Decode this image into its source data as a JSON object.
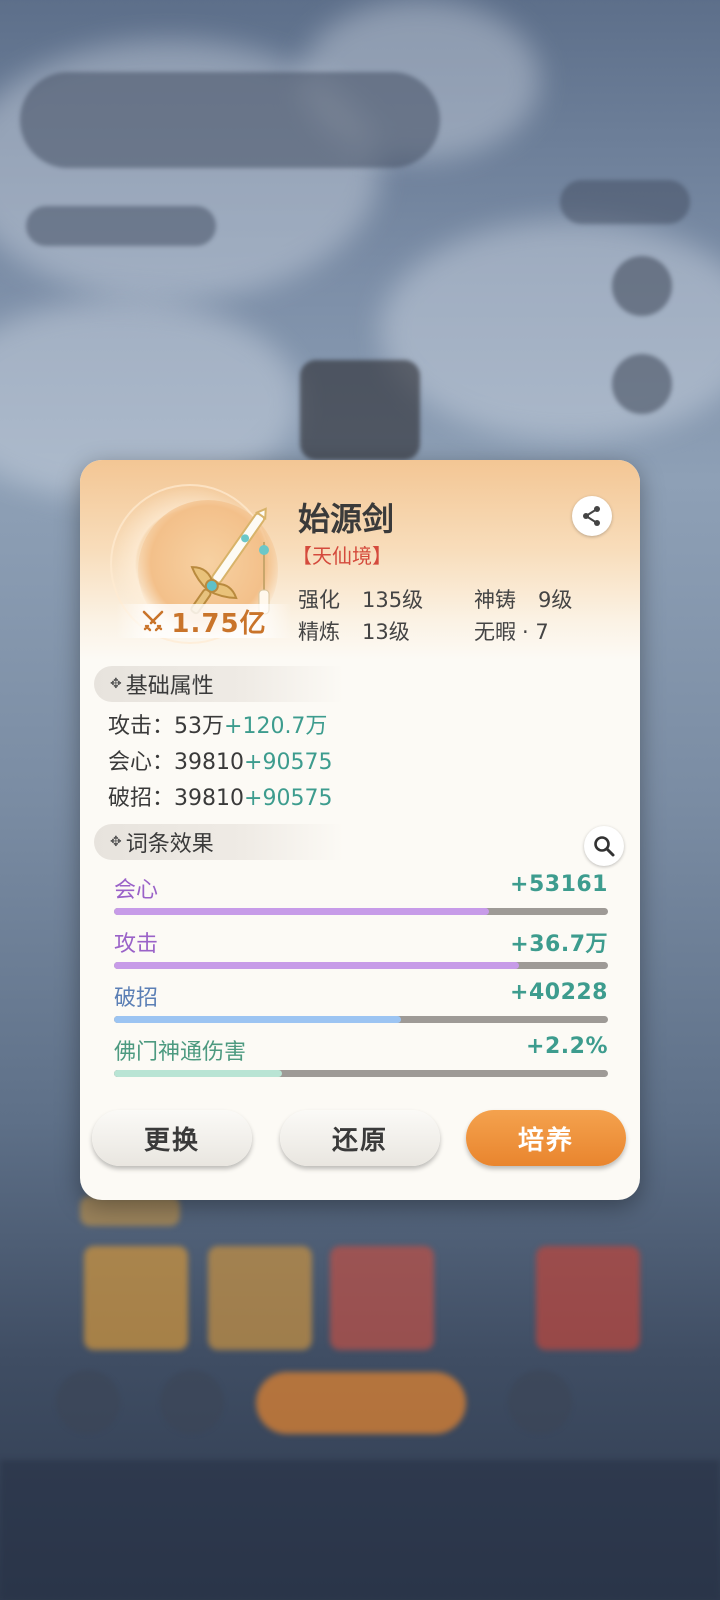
{
  "item": {
    "name": "始源剑",
    "tier": "【天仙境】",
    "power": "1.75亿",
    "stats": [
      {
        "label": "强化",
        "value": "135级"
      },
      {
        "label": "神铸",
        "value": "9级"
      },
      {
        "label": "精炼",
        "value": "13级"
      },
      {
        "label": "无暇",
        "value": "· 7"
      }
    ]
  },
  "base_section": {
    "title": "基础属性",
    "lines": [
      {
        "label": "攻击：",
        "base": "53万",
        "bonus": "+120.7万"
      },
      {
        "label": "会心：",
        "base": "39810",
        "bonus": "+90575"
      },
      {
        "label": "破招：",
        "base": "39810",
        "bonus": "+90575"
      }
    ]
  },
  "affix_section": {
    "title": "词条效果",
    "items": [
      {
        "name": "会心",
        "value": "+53161",
        "fill": 0.76,
        "color": "#c79be8",
        "name_color": "#9a62c8"
      },
      {
        "name": "攻击",
        "value": "+36.7万",
        "fill": 0.82,
        "color": "#c79be8",
        "name_color": "#9a62c8"
      },
      {
        "name": "破招",
        "value": "+40228",
        "fill": 0.58,
        "color": "#9cc4f2",
        "name_color": "#5b7fb5"
      },
      {
        "name": "佛门神通伤害",
        "value": "+2.2%",
        "fill": 0.34,
        "color": "#b9e4d4",
        "name_color": "#4d9a80"
      }
    ]
  },
  "buttons": {
    "replace": "更换",
    "restore": "还原",
    "train": "培养"
  },
  "icons": {
    "share": "share-icon",
    "search": "search-icon",
    "power": "crossed-swords-icon"
  }
}
